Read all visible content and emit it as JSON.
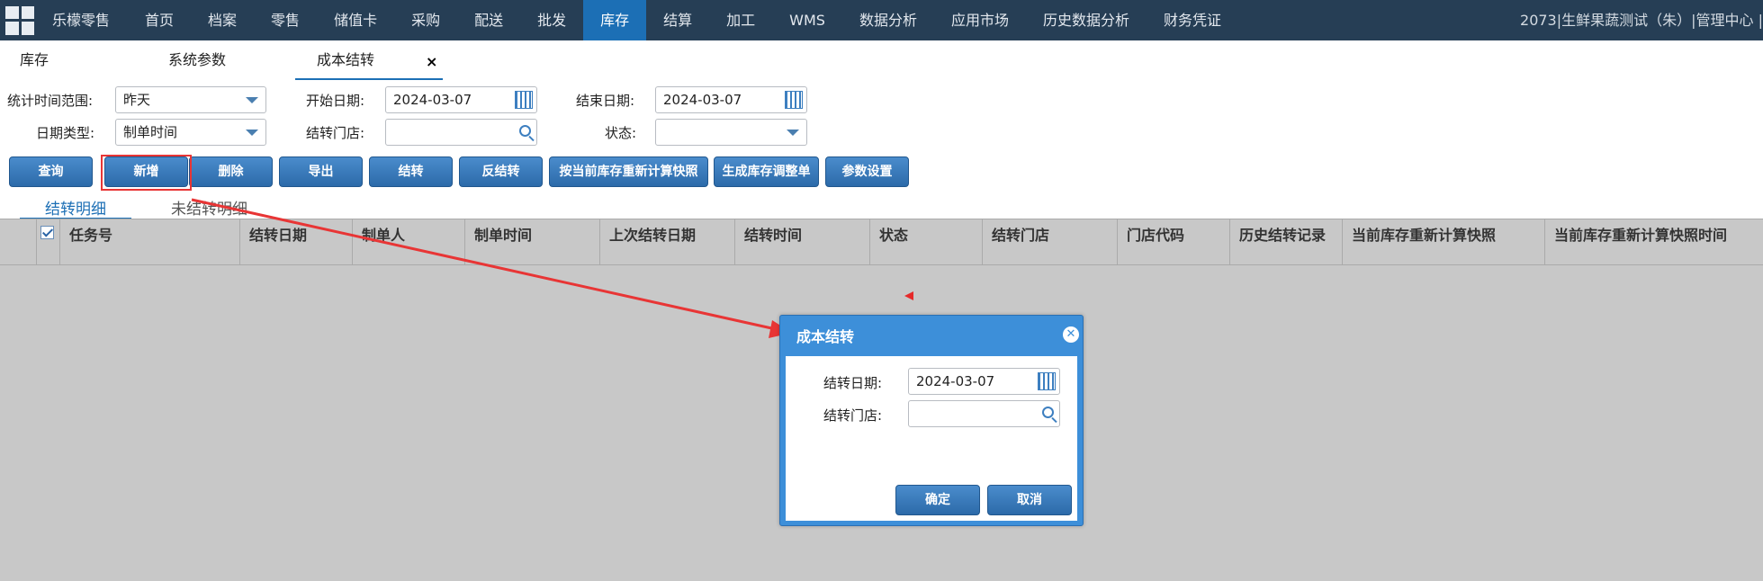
{
  "nav": {
    "brand": "乐檬零售",
    "items": [
      "首页",
      "档案",
      "零售",
      "储值卡",
      "采购",
      "配送",
      "批发",
      "库存",
      "结算",
      "加工",
      "WMS",
      "数据分析",
      "应用市场",
      "历史数据分析",
      "财务凭证"
    ],
    "active": "库存",
    "user": "2073|生鲜果蔬测试（朱）|管理中心 |"
  },
  "tabs": {
    "items": [
      "库存",
      "系统参数",
      "成本结转"
    ],
    "active": "成本结转",
    "close_glyph": "×"
  },
  "filter": {
    "range_label": "统计时间范围:",
    "range_value": "昨天",
    "start_label": "开始日期:",
    "start_value": "2024-03-07",
    "end_label": "结束日期:",
    "end_value": "2024-03-07",
    "date_type_label": "日期类型:",
    "date_type_value": "制单时间",
    "store_label": "结转门店:",
    "store_value": "",
    "status_label": "状态:",
    "status_value": ""
  },
  "toolbar": {
    "buttons": [
      "查询",
      "新增",
      "删除",
      "导出",
      "结转",
      "反结转",
      "按当前库存重新计算快照",
      "生成库存调整单",
      "参数设置"
    ]
  },
  "subtabs": {
    "items": [
      "结转明细",
      "未结转明细"
    ],
    "active": "结转明细"
  },
  "table": {
    "columns": [
      "任务号",
      "结转日期",
      "制单人",
      "制单时间",
      "上次结转日期",
      "结转时间",
      "状态",
      "结转门店",
      "门店代码",
      "历史结转记录",
      "当前库存重新计算快照",
      "当前库存重新计算快照时间"
    ]
  },
  "dialog": {
    "title": "成本结转",
    "close_glyph": "✕",
    "date_label": "结转日期:",
    "date_value": "2024-03-07",
    "store_label": "结转门店:",
    "store_value": "",
    "ok": "确定",
    "cancel": "取消"
  },
  "colors": {
    "nav_bg": "#263e55",
    "accent": "#1c6fb5",
    "annotation": "#e83535"
  }
}
